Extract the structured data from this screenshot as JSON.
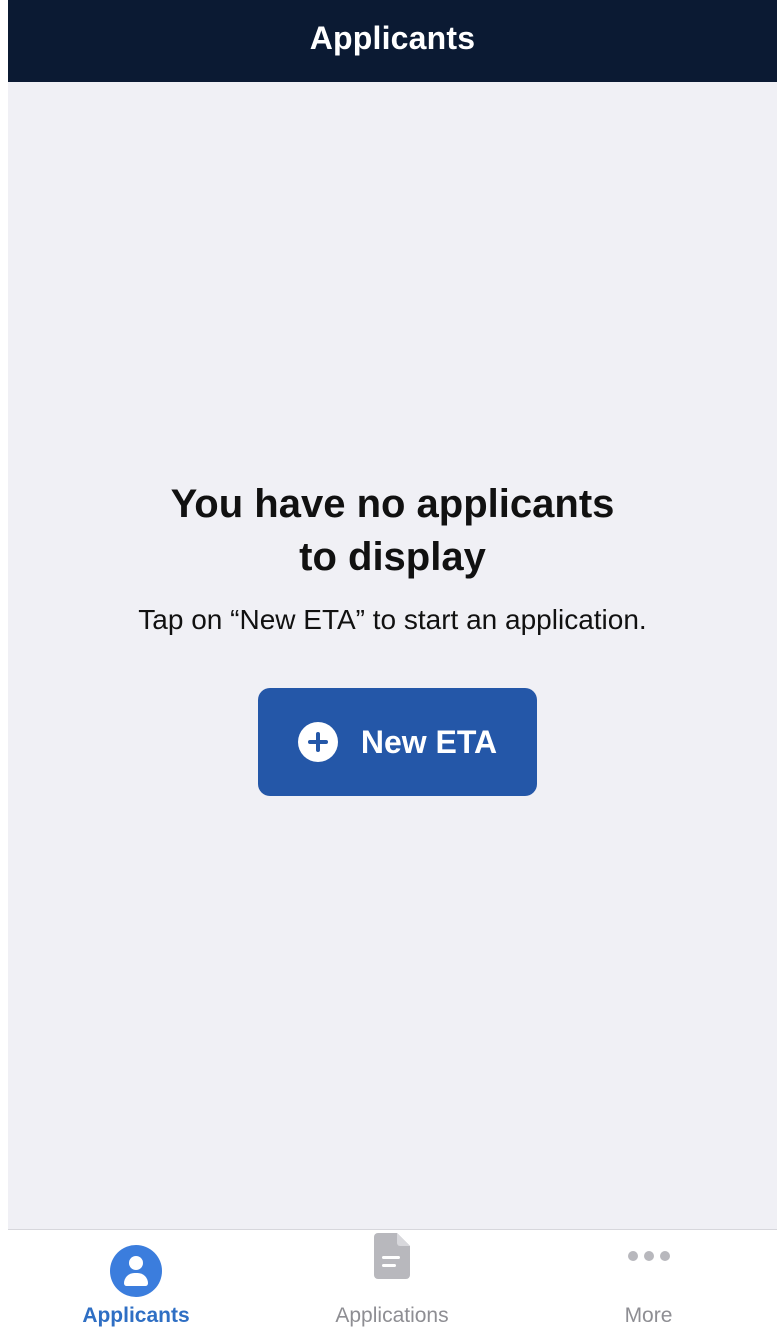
{
  "header": {
    "title": "Applicants"
  },
  "empty_state": {
    "title_line1": "You have no applicants",
    "title_line2": "to display",
    "subtitle": "Tap on “New ETA” to start an application."
  },
  "actions": {
    "new_eta_label": "New ETA",
    "new_eta_icon": "plus-circle-icon"
  },
  "tabs": [
    {
      "label": "Applicants",
      "icon": "person-icon",
      "active": true
    },
    {
      "label": "Applications",
      "icon": "document-icon",
      "active": false
    },
    {
      "label": "More",
      "icon": "more-icon",
      "active": false
    }
  ],
  "colors": {
    "header_background": "#0b1a33",
    "page_background": "#f0f0f5",
    "primary_button": "#2457a8",
    "active_tab": "#2f6fc4",
    "inactive_tab": "#8e8e93"
  }
}
